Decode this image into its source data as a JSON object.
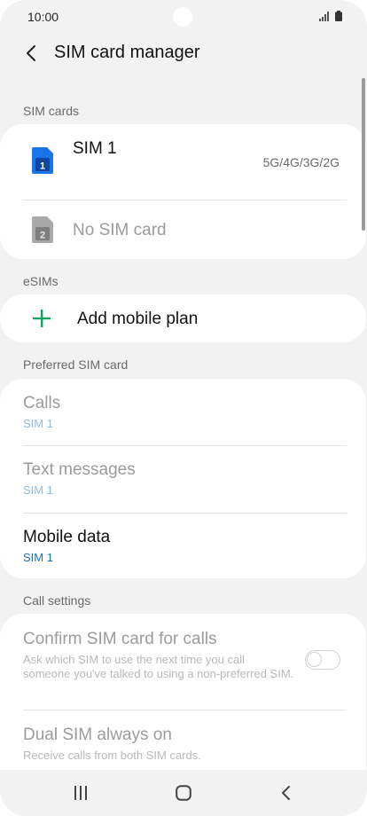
{
  "status_bar": {
    "time": "10:00"
  },
  "header": {
    "title": "SIM card manager"
  },
  "sections": {
    "sim_cards": "SIM cards",
    "esims": "eSIMs",
    "preferred": "Preferred SIM card",
    "call_settings": "Call settings"
  },
  "sim_cards": [
    {
      "badge": "1",
      "name": "SIM 1",
      "network": "5G/4G/3G/2G"
    },
    {
      "badge": "2",
      "name": "No SIM card"
    }
  ],
  "esims": {
    "add_label": "Add mobile plan"
  },
  "preferred": [
    {
      "title": "Calls",
      "value": "SIM 1"
    },
    {
      "title": "Text messages",
      "value": "SIM 1"
    },
    {
      "title": "Mobile data",
      "value": "SIM 1"
    }
  ],
  "call_settings": [
    {
      "title": "Confirm SIM card for calls",
      "description": "Ask which SIM to use the next time you call someone you've talked to using a non-preferred SIM."
    },
    {
      "title": "Dual SIM always on",
      "description": "Receive calls from both SIM cards."
    }
  ],
  "colors": {
    "sim1_blue": "#1a73e8",
    "accent_green": "#1aa260",
    "value_blue": "#1c6fb5",
    "disabled_text": "#9b9b9b",
    "disabled_value": "#8fbde3"
  }
}
